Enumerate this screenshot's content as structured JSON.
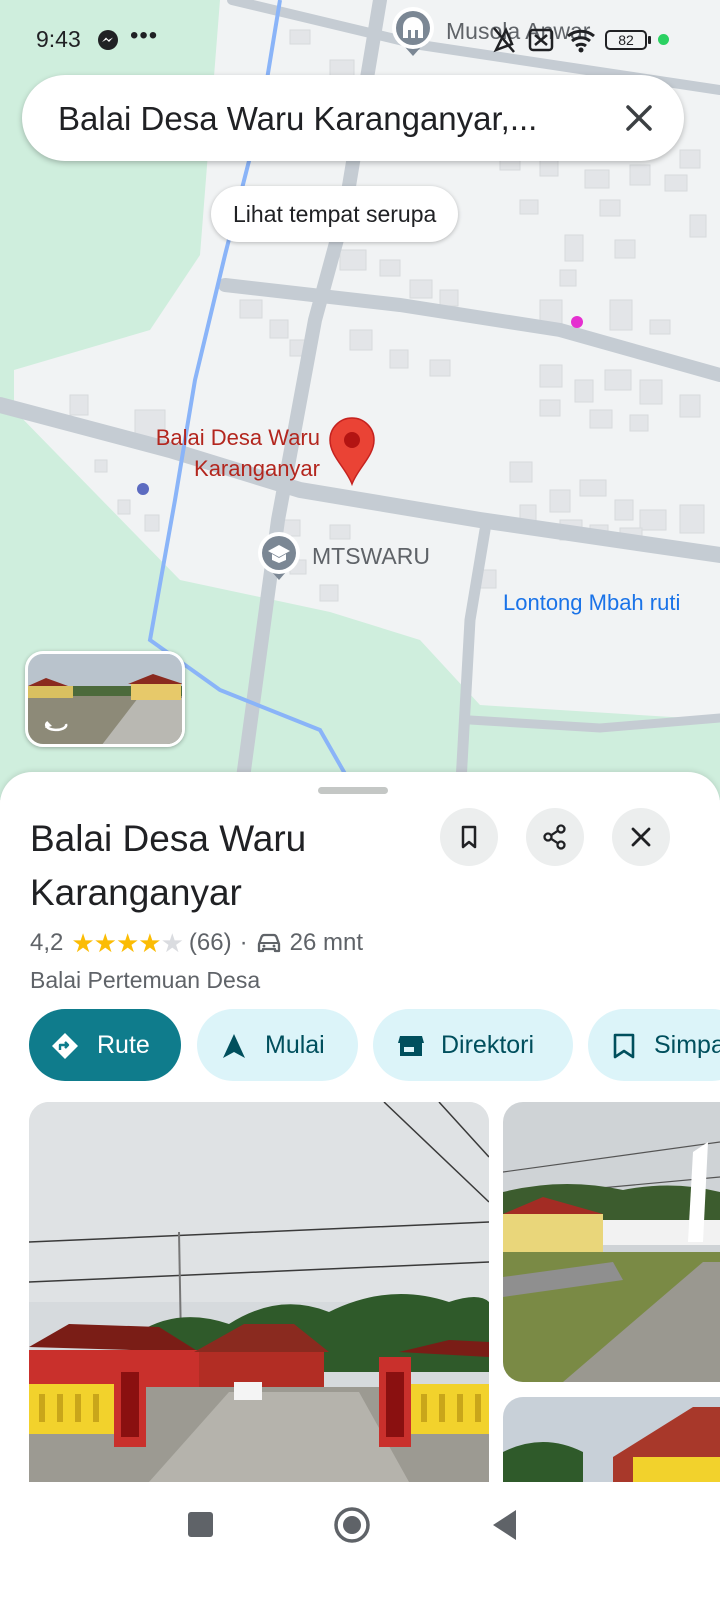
{
  "status_bar": {
    "time": "9:43",
    "dots": "•••",
    "battery": "82",
    "icons": [
      "messenger-icon",
      "location-off-icon",
      "no-sim-icon",
      "wifi-icon",
      "battery-icon"
    ]
  },
  "search": {
    "query": "Balai Desa Waru Karanganyar,..."
  },
  "map": {
    "similar_places_chip": "Lihat tempat serupa",
    "pins": {
      "main": "Balai Desa Waru\nKaranganyar",
      "school": "MTSWARU",
      "restaurant": "Lontong Mbah ruti",
      "mosque": "Musola Anwar"
    },
    "colors": {
      "land": "#cfeedd",
      "built": "#f1f3f4",
      "road": "#c5ccd3",
      "water": "#8ab4f8",
      "pin": "#ea4335"
    }
  },
  "place": {
    "name": "Balai Desa Waru Karanganyar",
    "rating": "4,2",
    "rating_value": 4.2,
    "stars": {
      "full": "★★★★",
      "empty": "★"
    },
    "reviews": "(66)",
    "separator": "·",
    "drive_time": "26 mnt",
    "category": "Balai Pertemuan Desa"
  },
  "actions": {
    "route": "Rute",
    "start": "Mulai",
    "directory": "Direktori",
    "save": "Simpan"
  },
  "colors": {
    "accent": "#0f7c8c",
    "chip": "#dcf4f9",
    "chip_text": "#004f5d",
    "star": "#fbbc04"
  }
}
